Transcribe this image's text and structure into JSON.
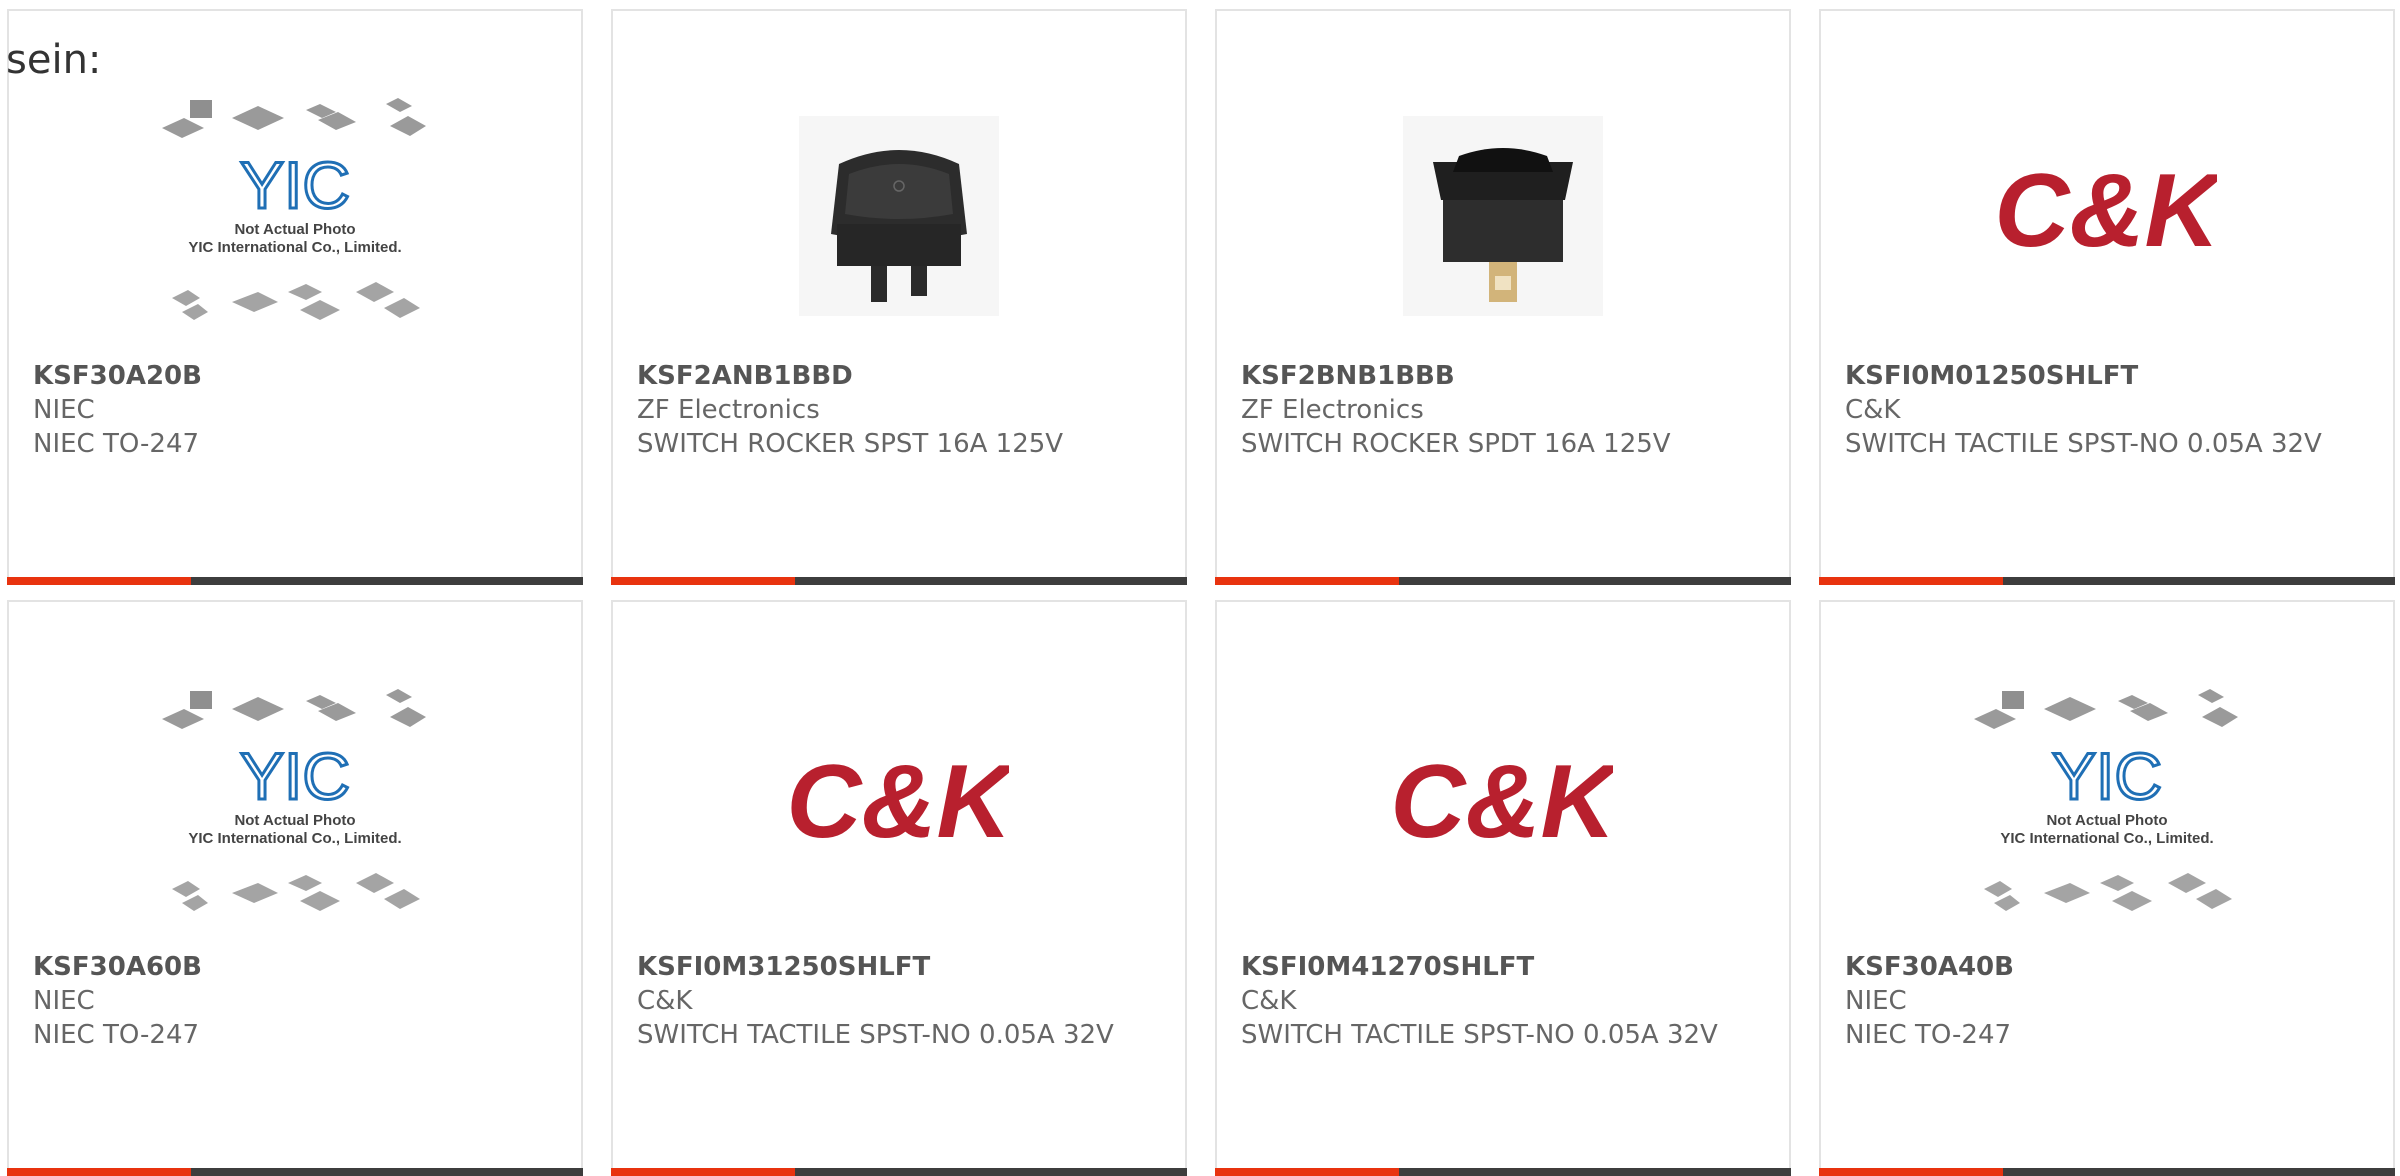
{
  "intro_text": "sein:",
  "colors": {
    "accent_bar": "#e8330f",
    "dark_bar": "#3d3d3d",
    "ck_red": "#b8202e",
    "yic_blue": "#1f6fb5"
  },
  "cards": [
    {
      "part": "KSF30A20B",
      "maker": "NIEC",
      "desc": "NIEC TO-247",
      "image": "yic-placeholder",
      "image_text_1": "Not Actual Photo",
      "image_text_2": "YIC International Co., Limited."
    },
    {
      "part": "KSF2ANB1BBD",
      "maker": "ZF Electronics",
      "desc": "SWITCH ROCKER SPST 16A 125V",
      "image": "rocker-switch-photo"
    },
    {
      "part": "KSF2BNB1BBB",
      "maker": "ZF Electronics",
      "desc": "SWITCH ROCKER SPDT 16A 125V",
      "image": "rocker-switch-photo"
    },
    {
      "part": "KSFI0M01250SHLFT",
      "maker": "C&K",
      "desc": "SWITCH TACTILE SPST-NO 0.05A 32V",
      "image": "ck-logo",
      "logo_text": "C&K"
    },
    {
      "part": "KSF30A60B",
      "maker": "NIEC",
      "desc": "NIEC TO-247",
      "image": "yic-placeholder",
      "image_text_1": "Not Actual Photo",
      "image_text_2": "YIC International Co., Limited."
    },
    {
      "part": "KSFI0M31250SHLFT",
      "maker": "C&K",
      "desc": "SWITCH TACTILE SPST-NO 0.05A 32V",
      "image": "ck-logo",
      "logo_text": "C&K"
    },
    {
      "part": "KSFI0M41270SHLFT",
      "maker": "C&K",
      "desc": "SWITCH TACTILE SPST-NO 0.05A 32V",
      "image": "ck-logo",
      "logo_text": "C&K"
    },
    {
      "part": "KSF30A40B",
      "maker": "NIEC",
      "desc": "NIEC TO-247",
      "image": "yic-placeholder",
      "image_text_1": "Not Actual Photo",
      "image_text_2": "YIC International Co., Limited."
    }
  ]
}
